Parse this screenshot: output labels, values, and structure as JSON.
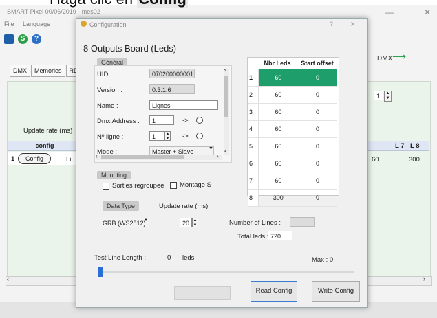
{
  "caption": {
    "prefix": "Haga clic en ",
    "bold": "Config"
  },
  "main": {
    "title": "SMART Pixel 00/06/2019 - mes02",
    "menu": [
      "File",
      "Language"
    ],
    "tabs": [
      "DMX",
      "Memories",
      "RD"
    ],
    "dmx_label": "DMX",
    "update_rate_label": "Update rate (ms)",
    "grid_header": "config",
    "row_num": "1",
    "config_button": "Config",
    "cell_text": "Li",
    "right_headers": [
      "L 7",
      "L 8"
    ],
    "right_values": [
      "60",
      "300"
    ],
    "spin_value": "1"
  },
  "dialog": {
    "title": "Configuration",
    "help": "?",
    "close": "×",
    "heading": "8 Outputs Board (Leds)",
    "general": {
      "label": "Général",
      "uid_label": "UID :",
      "uid": "070200000001",
      "version_label": "Version :",
      "version": "0.3.1.6",
      "name_label": "Name :",
      "name": "Lignes",
      "dmx_label": "Dmx Address :",
      "dmx": "1",
      "ligne_label": "Nº ligne :",
      "ligne": "1",
      "mode_label": "Mode :",
      "mode": "Master + Slave",
      "arrow": "->"
    },
    "mounting": {
      "label": "Mounting",
      "opt1": "Sorties regroupee",
      "opt2": "Montage S"
    },
    "data_type": {
      "label": "Data Type",
      "value": "GRB (WS2812)",
      "update_rate_label": "Update rate (ms)",
      "update_rate": "20"
    },
    "table": {
      "headers": [
        "Nbr Leds",
        "Start offset"
      ],
      "rows": [
        {
          "n": "1",
          "leds": "60",
          "offset": "0"
        },
        {
          "n": "2",
          "leds": "60",
          "offset": "0"
        },
        {
          "n": "3",
          "leds": "60",
          "offset": "0"
        },
        {
          "n": "4",
          "leds": "60",
          "offset": "0"
        },
        {
          "n": "5",
          "leds": "60",
          "offset": "0"
        },
        {
          "n": "6",
          "leds": "60",
          "offset": "0"
        },
        {
          "n": "7",
          "leds": "60",
          "offset": "0"
        },
        {
          "n": "8",
          "leds": "300",
          "offset": "0"
        }
      ]
    },
    "lines_label": "Number of Lines :",
    "lines_value": "",
    "total_label": "Total leds :",
    "total_value": "720",
    "test_label": "Test Line Length :",
    "test_value": "0",
    "test_unit": "leds",
    "max_label": "Max : 0",
    "read_button": "Read Config",
    "write_button": "Write Config"
  }
}
